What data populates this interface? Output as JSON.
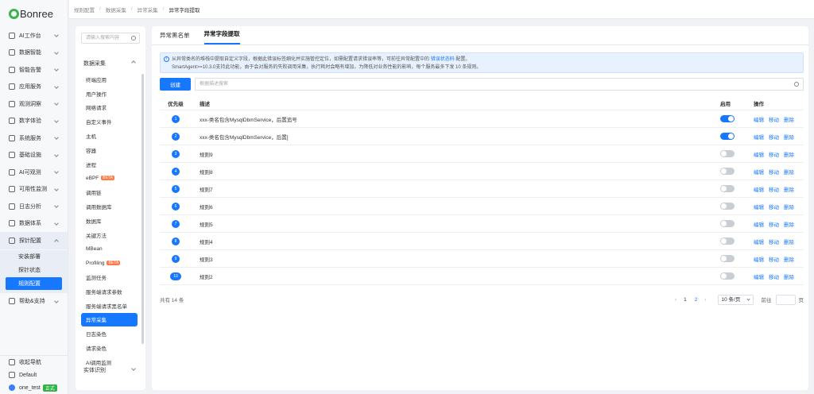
{
  "brand": "Bonree",
  "nav": {
    "items": [
      {
        "label": "AI工作台"
      },
      {
        "label": "数据智能"
      },
      {
        "label": "智能告警"
      },
      {
        "label": "应用服务"
      },
      {
        "label": "观测洞察"
      },
      {
        "label": "数字体验"
      },
      {
        "label": "系统服务"
      },
      {
        "label": "基础设施"
      },
      {
        "label": "AI可观测"
      },
      {
        "label": "可用性监测"
      },
      {
        "label": "日志分析"
      },
      {
        "label": "数据体系"
      }
    ],
    "open_item": {
      "label": "探针配置"
    },
    "sub_items": [
      {
        "label": "安装部署",
        "active": false
      },
      {
        "label": "探针状态",
        "active": false
      },
      {
        "label": "规则配置",
        "active": true
      }
    ],
    "help": {
      "label": "帮助&支持"
    },
    "footer": {
      "collapse": "收起导航",
      "workspace": "Default",
      "user": "one_test",
      "user_tag": "正式"
    }
  },
  "breadcrumb": [
    "规则配置",
    "数据采集",
    "异常采集",
    "异常字段提取"
  ],
  "menu": {
    "search_placeholder": "请输入搜索内容",
    "group": "数据采集",
    "items": [
      {
        "label": "终端应用",
        "active": false
      },
      {
        "label": "用户操作",
        "active": false
      },
      {
        "label": "网络请求",
        "active": false
      },
      {
        "label": "自定义事件",
        "active": false
      },
      {
        "label": "主机",
        "active": false
      },
      {
        "label": "容器",
        "active": false
      },
      {
        "label": "进程",
        "active": false
      },
      {
        "label": "eBPF",
        "badge": "BETA",
        "active": false
      },
      {
        "label": "调用链",
        "active": false
      },
      {
        "label": "调用数据库",
        "active": false
      },
      {
        "label": "数据库",
        "active": false
      },
      {
        "label": "关键方法",
        "active": false
      },
      {
        "label": "MBean",
        "active": false
      },
      {
        "label": "Profiling",
        "badge": "BETA",
        "active": false
      },
      {
        "label": "监测任务",
        "active": false
      },
      {
        "label": "服务端请求参数",
        "active": false
      },
      {
        "label": "服务端请求黑名单",
        "active": false
      },
      {
        "label": "异常采集",
        "active": true
      },
      {
        "label": "日志染色",
        "active": false
      },
      {
        "label": "请求染色",
        "active": false
      },
      {
        "label": "AI调用监测",
        "active": false
      }
    ],
    "bottom_group": "实体识别"
  },
  "main": {
    "tabs": [
      {
        "label": "异常黑名单",
        "active": false
      },
      {
        "label": "异常字段提取",
        "active": true
      }
    ],
    "alert": {
      "line1_pre": "从异常类名的堆栈中提取自定义字段，根据此错误标签细化并实施管控定位，如需配置请求错误率等，可前往异常配置中的",
      "line1_link": "错误状态码",
      "line1_post": "配置。",
      "line2": "SmartAgent>=10.3.0支持此功能，由于会对服务的失败调用采集，执行耗时会略有增加，为降低对业务性能的影响，每个服务最多下发 10 条规则。"
    },
    "create_button": "创建",
    "search_placeholder": "根据描述搜索",
    "table": {
      "headers": {
        "priority": "优先级",
        "description": "描述",
        "enabled": "启用",
        "actions": "操作"
      },
      "rows": [
        {
          "priority": "1",
          "description": "xxx-类名包含MysqlDbmService，后置追号",
          "enabled": true
        },
        {
          "priority": "2",
          "description": "xxx-类名包含MysqlDbmService，后置]",
          "enabled": true
        },
        {
          "priority": "3",
          "description": "规则9",
          "enabled": false
        },
        {
          "priority": "4",
          "description": "规则8",
          "enabled": false
        },
        {
          "priority": "5",
          "description": "规则7",
          "enabled": false
        },
        {
          "priority": "6",
          "description": "规则6",
          "enabled": false
        },
        {
          "priority": "7",
          "description": "规则5",
          "enabled": false
        },
        {
          "priority": "8",
          "description": "规则4",
          "enabled": false
        },
        {
          "priority": "9",
          "description": "规则3",
          "enabled": false
        },
        {
          "priority": "10",
          "description": "规则2",
          "enabled": false
        }
      ],
      "actions": {
        "edit": "编辑",
        "move": "移动",
        "delete": "删除"
      }
    },
    "pagination": {
      "total": "共有 14 条",
      "pages": [
        "1",
        "2"
      ],
      "current": "2",
      "page_size": "10 条/页",
      "goto_label": "前往",
      "goto_unit": "页"
    }
  },
  "colors": {
    "accent": "#1677ff",
    "beta": "#ff7a45",
    "tag_green": "#2fb344"
  }
}
